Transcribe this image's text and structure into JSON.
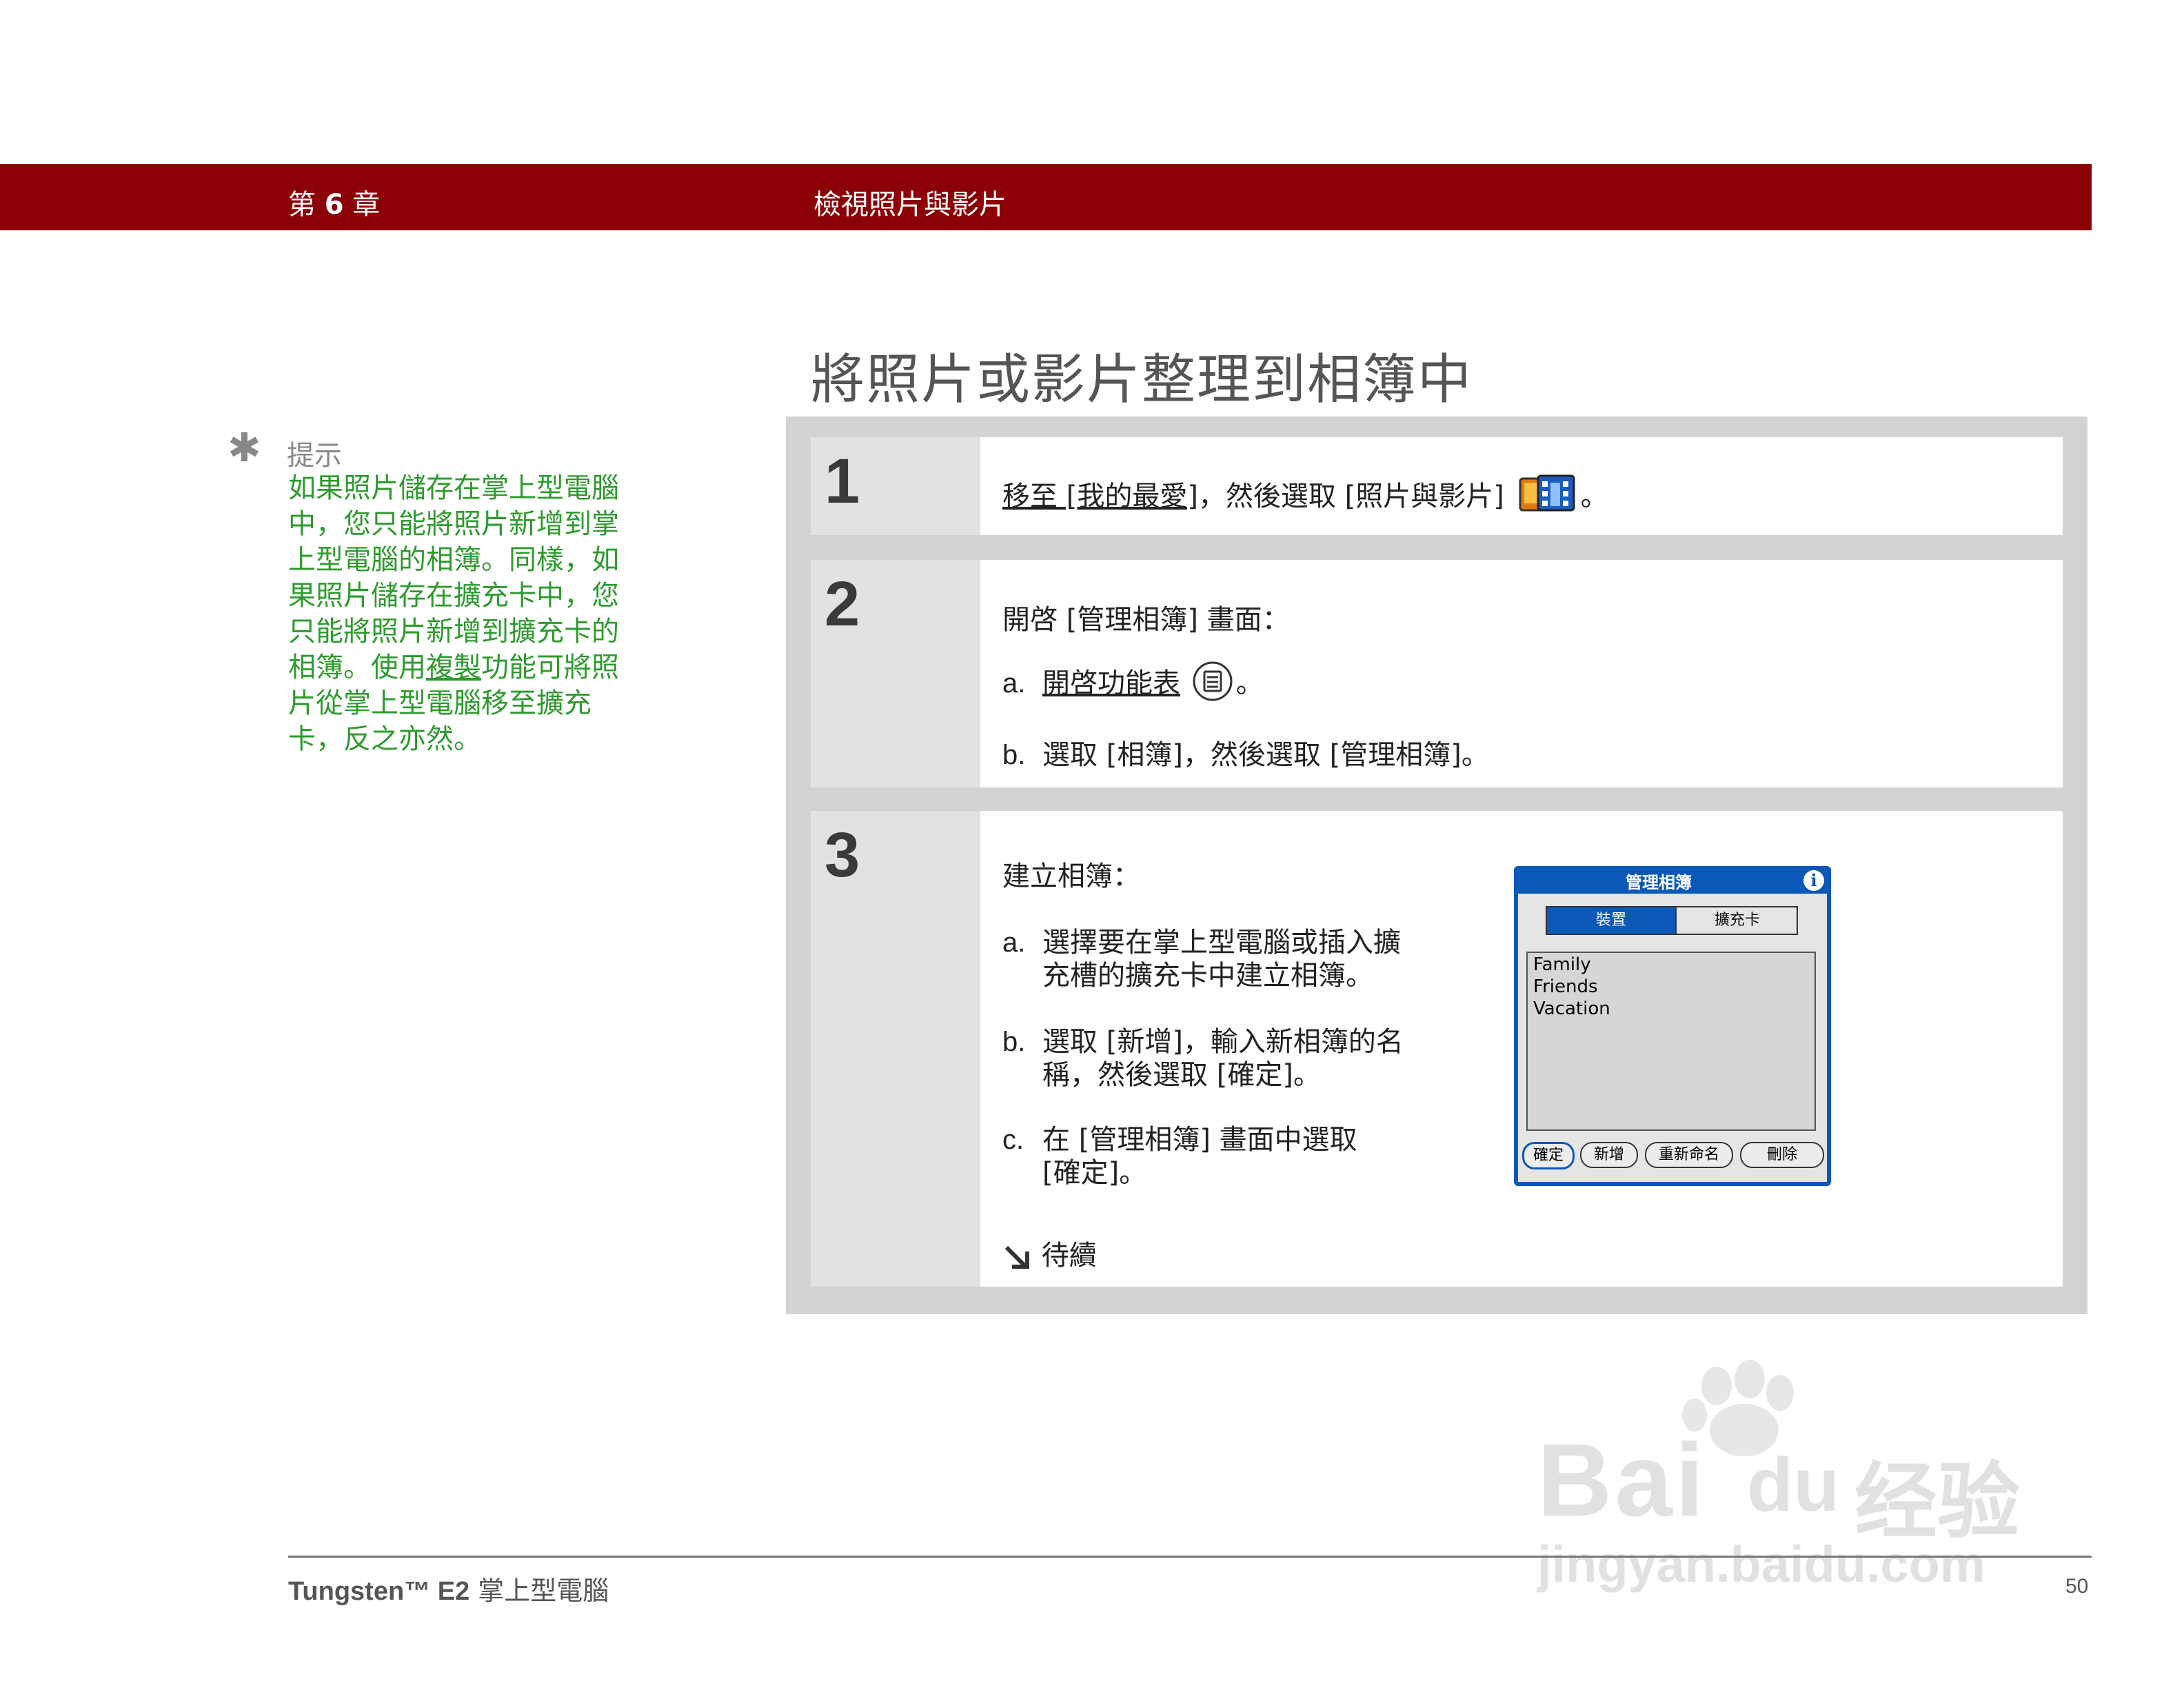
{
  "header": {
    "chapter_prefix": "第",
    "chapter_number": "6",
    "chapter_suffix": "章",
    "section": "檢視照片與影片"
  },
  "title": "將照片或影片整理到相簿中",
  "tip": {
    "label": "提示",
    "text_before": "如果照片儲存在掌上型電腦中，您只能將照片新增到掌上型電腦的相簿。同樣，如果照片儲存在擴充卡中，您只能將照片新增到擴充卡的相簿。使用",
    "link": "複製",
    "text_after": "功能可將照片從掌上型電腦移至擴充卡，反之亦然。"
  },
  "steps": [
    {
      "number": "1",
      "link": "移至 [我的最愛]",
      "text": "，然後選取 [照片與影片]",
      "end": "。",
      "icon": "photos-videos-icon"
    },
    {
      "number": "2",
      "intro": "開啓 [管理相簿] 畫面：",
      "a_label": "a.",
      "a_link": "開啓功能表",
      "a_end": "。",
      "a_icon": "menu-icon",
      "b_label": "b.",
      "b_text": "選取 [相簿]，然後選取 [管理相簿]。"
    },
    {
      "number": "3",
      "intro": "建立相簿：",
      "a_label": "a.",
      "a_line1": "選擇要在掌上型電腦或插入擴",
      "a_line2": "充槽的擴充卡中建立相簿。",
      "b_label": "b.",
      "b_line1": "選取 [新增]，輸入新相簿的名",
      "b_line2": "稱，然後選取 [確定]。",
      "c_label": "c.",
      "c_line1": "在 [管理相簿] 畫面中選取",
      "c_line2": "[確定]。",
      "continued": "待續"
    }
  ],
  "palm_screen": {
    "title": "管理相簿",
    "info": "i",
    "tabs": [
      "裝置",
      "擴充卡"
    ],
    "albums": [
      "Family",
      "Friends",
      "Vacation"
    ],
    "buttons": [
      "確定",
      "新增",
      "重新命名",
      "刪除"
    ]
  },
  "watermark": {
    "brand_left": "Bai",
    "brand_right": "du",
    "cn": "经验",
    "url": "jingyan.baidu.com"
  },
  "footer": {
    "product": "Tungsten™ E2",
    "product_suffix": "掌上型電腦",
    "page": "50"
  },
  "colors": {
    "header_band": "#8b0005",
    "tip_text": "#2e9b2e",
    "palm_blue": "#0a58b8"
  }
}
